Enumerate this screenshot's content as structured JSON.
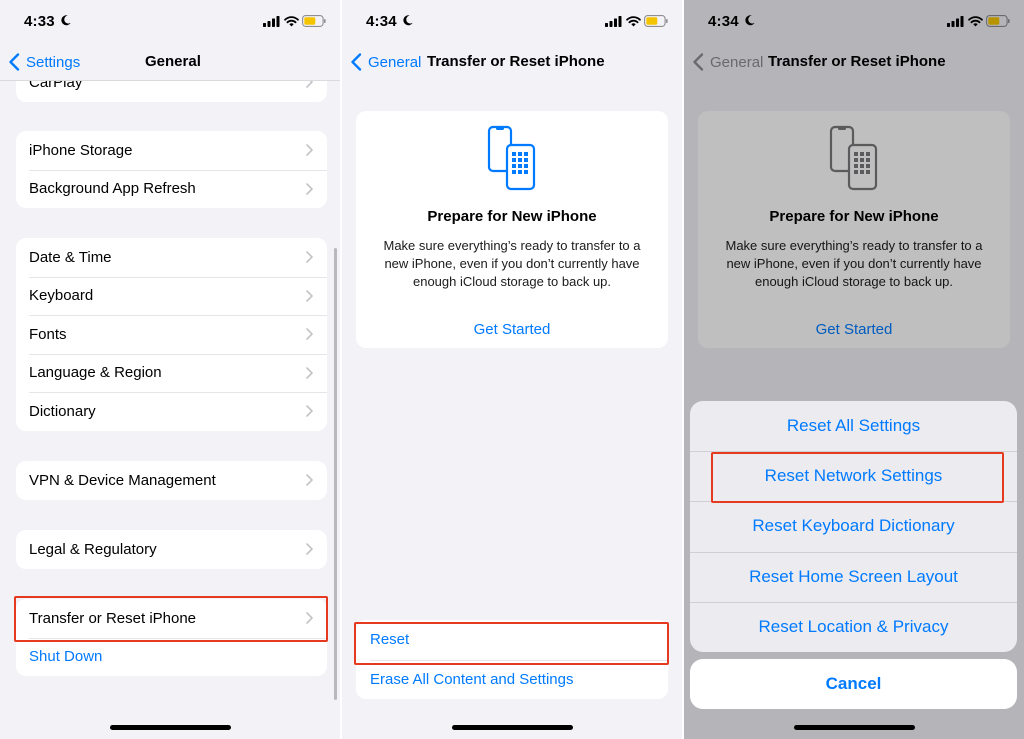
{
  "colors": {
    "accent": "#007aff",
    "highlight": "#e53a20",
    "background": "#f2f2f7"
  },
  "panel1": {
    "time": "4:33",
    "nav": {
      "back_label": "Settings",
      "title": "General"
    },
    "partial_row": "CarPlay",
    "group1": [
      "iPhone Storage",
      "Background App Refresh"
    ],
    "group2": [
      "Date & Time",
      "Keyboard",
      "Fonts",
      "Language & Region",
      "Dictionary"
    ],
    "group3": [
      "VPN & Device Management"
    ],
    "group4": [
      "Legal & Regulatory"
    ],
    "group5": [
      "Transfer or Reset iPhone",
      "Shut Down"
    ]
  },
  "panel2": {
    "time": "4:34",
    "nav": {
      "back_label": "General",
      "title": "Transfer or Reset iPhone"
    },
    "card": {
      "icon": "phones-transfer-icon",
      "title": "Prepare for New iPhone",
      "description": "Make sure everything’s ready to transfer to a new iPhone, even if you don’t currently have enough iCloud storage to back up.",
      "link": "Get Started"
    },
    "bottom": [
      "Reset",
      "Erase All Content and Settings"
    ]
  },
  "panel3": {
    "time": "4:34",
    "nav": {
      "back_label": "General",
      "title": "Transfer or Reset iPhone"
    },
    "card": {
      "title": "Prepare for New iPhone",
      "description": "Make sure everything’s ready to transfer to a new iPhone, even if you don’t currently have enough iCloud storage to back up.",
      "link": "Get Started"
    },
    "sheet": [
      "Reset All Settings",
      "Reset Network Settings",
      "Reset Keyboard Dictionary",
      "Reset Home Screen Layout",
      "Reset Location & Privacy"
    ],
    "cancel": "Cancel"
  }
}
